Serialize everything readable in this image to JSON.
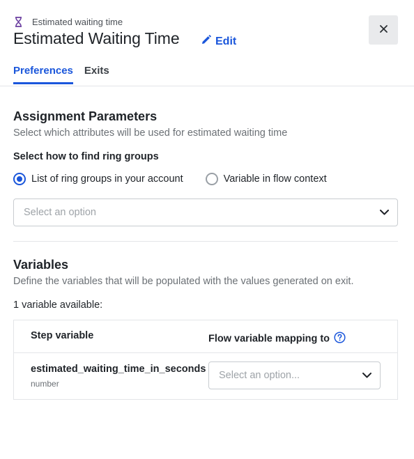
{
  "header": {
    "breadcrumb": "Estimated waiting time",
    "title": "Estimated Waiting Time",
    "edit_label": "Edit",
    "close_icon": "close-icon"
  },
  "tabs": [
    {
      "label": "Preferences",
      "active": true
    },
    {
      "label": "Exits",
      "active": false
    }
  ],
  "assignment": {
    "title": "Assignment Parameters",
    "subtitle": "Select which attributes will be used for estimated waiting time",
    "find_label": "Select how to find ring groups",
    "radio_options": [
      {
        "label": "List of ring groups in your account",
        "checked": true
      },
      {
        "label": "Variable in flow context",
        "checked": false
      }
    ],
    "select_placeholder": "Select an option"
  },
  "variables": {
    "title": "Variables",
    "subtitle": "Define the variables that will be populated with the values generated on exit.",
    "count_text": "1 variable available:",
    "columns": [
      "Step variable",
      "Flow variable mapping to"
    ],
    "rows": [
      {
        "name": "estimated_waiting_time_in_seconds",
        "type": "number",
        "mapping_placeholder": "Select an option..."
      }
    ]
  },
  "colors": {
    "accent": "#1a56db",
    "hourglass": "#6b3fa0",
    "text": "#1f2328",
    "muted": "#6b7075"
  }
}
